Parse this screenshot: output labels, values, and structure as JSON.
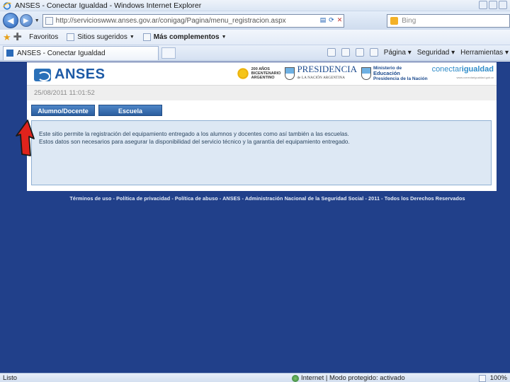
{
  "window": {
    "title": "ANSES - Conectar Igualdad - Windows Internet Explorer"
  },
  "address_bar": {
    "url": "http://servicioswww.anses.gov.ar/conigag/Pagina/menu_registracion.aspx",
    "search_placeholder": "Bing"
  },
  "favorites_bar": {
    "favorites_label": "Favoritos",
    "items": [
      {
        "label": "Sitios sugeridos"
      },
      {
        "label": "Más complementos"
      }
    ]
  },
  "tab_bar": {
    "active_tab_title": "ANSES - Conectar Igualdad",
    "commands": [
      "Página",
      "Seguridad",
      "Herramientas"
    ]
  },
  "page": {
    "logo_text": "ANSES",
    "bicentenario": [
      "200 AÑOS",
      "BICENTENARIO",
      "ARGENTINO"
    ],
    "presidencia": {
      "title": "PRESIDENCIA",
      "subtitle": "de LA NACIÓN ARGENTINA"
    },
    "ministerio": [
      "Ministerio de",
      "Educación",
      "Presidencia de la Nación"
    ],
    "conectar": {
      "part1": "conectar",
      "part2": "igualdad",
      "subtitle": "www.conectarigualdad.gob.ar"
    },
    "datetime": "25/08/2011 11:01:52",
    "tabs": [
      {
        "label": "Alumno/Docente"
      },
      {
        "label": "Escuela"
      }
    ],
    "info_text": "Este sitio permite la registración del equipamiento entregado a los alumnos y docentes como así también a las escuelas. Estos datos son necesarios para asegurar la disponibilidad del servicio técnico y la garantía del equipamiento entregado.",
    "footer": "Términos de uso - Política de privacidad - Política de abuso - ANSES - Administración Nacional de la Seguridad Social - 2011 - Todos los Derechos Reservados"
  },
  "status_bar": {
    "status_text": "Listo",
    "zone_text": "Internet | Modo protegido: activado",
    "zoom": "100%"
  },
  "colors": {
    "page_background": "#21408a",
    "tab_button": "#2b5e9f",
    "info_box": "#dde8f4",
    "arrow": "#e0231c"
  }
}
